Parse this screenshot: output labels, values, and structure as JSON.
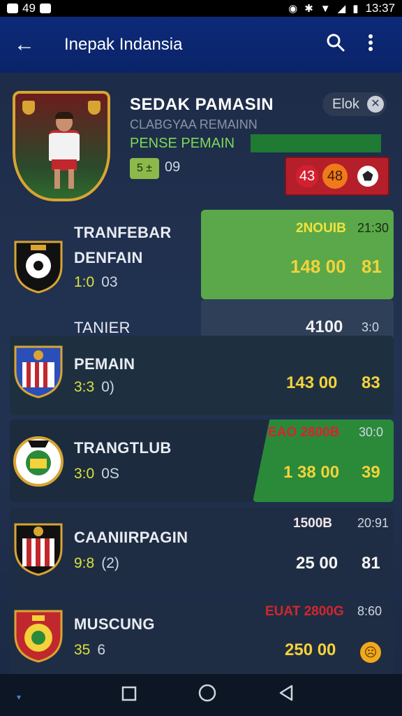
{
  "status_bar": {
    "left_icons": [
      "mail-icon",
      "notification-icon"
    ],
    "left_text": "49",
    "time": "13:37"
  },
  "app_bar": {
    "title": "Inepak Indansia"
  },
  "profile": {
    "name": "SEDAK PAMASIN",
    "subtitle": "CLABGYAA REMAINN",
    "role": "PENSE PEMAIN",
    "stat_chip": "5 ±",
    "stat_value": "09",
    "status_chip": "Elok",
    "score_a": "43",
    "score_b": "48"
  },
  "rows": [
    {
      "label_line1": "TRANFEBAR",
      "label_line2": "DENFAIN",
      "score_main": "1:0",
      "score_sub": "03",
      "tag": "2NOUIB",
      "time": "21:30",
      "value_main": "148 00",
      "value_side": "81"
    },
    {
      "label_line1": "TANIER",
      "value_main": "4100",
      "value_side": "3:0"
    },
    {
      "label_line1": "PEMAIN",
      "score_main": "3:3",
      "score_sub": "0)",
      "value_main": "143 00",
      "value_side": "83"
    },
    {
      "label_line1": "TRANGTLUB",
      "score_main": "3:0",
      "score_sub": "0S",
      "tag": "EAO 2800B",
      "time": "30:0",
      "value_main": "1 38 00",
      "value_side": "39"
    },
    {
      "label_line1": "CAANIIRPAGIN",
      "score_main": "9:8",
      "score_sub": "(2)",
      "tag": "1500B",
      "time": "20:91",
      "value_main": "25 00",
      "value_side": "81"
    },
    {
      "label_line1": "MUSCUNG",
      "score_main": "35",
      "score_sub": "6",
      "tag": "EUAT 2800G",
      "time": "8:60",
      "value_main": "250 00"
    }
  ],
  "colors": {
    "accent_yellow": "#f4d23a",
    "green_panel": "#5aa84a",
    "app_bar": "#0d2a7a",
    "red": "#b51f2a"
  }
}
